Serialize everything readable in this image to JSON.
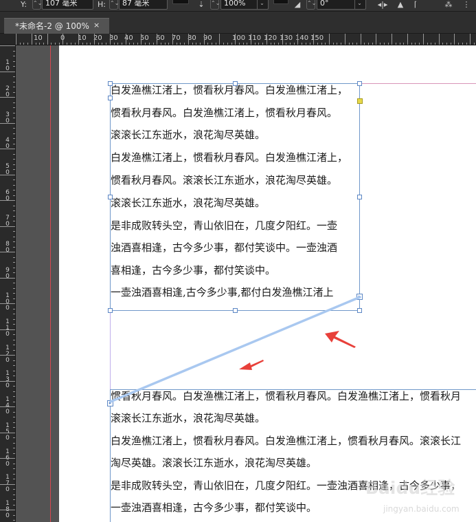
{
  "control_bar": {
    "y_label": "Y:",
    "y_value": "107 毫米",
    "h_label": "H:",
    "h_value": "87 毫米",
    "scale_value": "100%",
    "angle_value": "0°",
    "spin_glyph": "⌃⌄",
    "dropdown_glyph": "⌄",
    "icons": [
      "align-baseline-icon",
      "shear-icon",
      "flip-icon",
      "rotate-icon",
      "pathfinder-icon"
    ]
  },
  "document_tab": {
    "title": "*未命名-2 @ 100%",
    "close": "×"
  },
  "ruler_h": {
    "labels": [
      "10",
      "0",
      "10",
      "20",
      "30",
      "40",
      "50",
      "60",
      "70",
      "80",
      "90",
      "100",
      "110",
      "120",
      "130",
      "140",
      "150"
    ]
  },
  "ruler_v": {
    "labels": [
      "10",
      "20",
      "30",
      "40",
      "50",
      "60",
      "70",
      "80",
      "90",
      "100",
      "110",
      "120",
      "130",
      "140",
      "150",
      "160",
      "170",
      "180"
    ]
  },
  "frame_top": {
    "lines": [
      "白发渔樵江渚上，惯看秋月春风。白发渔樵江渚上，",
      "惯看秋月春风。白发渔樵江渚上，惯看秋月春风。",
      "滚滚长江东逝水，浪花淘尽英雄。",
      "白发渔樵江渚上，惯看秋月春风。白发渔樵江渚上，",
      "惯看秋月春风。滚滚长江东逝水，浪花淘尽英雄。",
      "滚滚长江东逝水，浪花淘尽英雄。",
      "是非成败转头空，青山依旧在，几度夕阳红。一壶",
      "浊酒喜相逢，古今多少事，都付笑谈中。一壶浊酒",
      "喜相逢，古今多少事，都付笑谈中。",
      "一壶浊酒喜相逢,古今多少事,都付白发渔樵江渚上"
    ]
  },
  "frame_bottom": {
    "lines": [
      "惯看秋月春风。白发渔樵江渚上，惯看秋月春风。白发渔樵江渚上，惯看秋月",
      "滚滚长江东逝水，浪花淘尽英雄。",
      "白发渔樵江渚上，惯看秋月春风。白发渔樵江渚上，惯看秋月春风。滚滚长江",
      "淘尽英雄。滚滚长江东逝水，浪花淘尽英雄。",
      "是非成败转头空，青山依旧在，几度夕阳红。一壶浊酒喜相逢，古今多少事，",
      "一壶浊酒喜相逢，古今多少事，都付笑谈中。"
    ]
  },
  "thread": {
    "line_color": "#a9c8f0",
    "arrow_color": "#e8403a"
  },
  "watermark": {
    "brand": "Baidu经验",
    "url": "jingyan.baidu.com"
  },
  "colors": {
    "frame_border": "#6f97c9",
    "bleed": "#d9474e",
    "page": "#ffffff",
    "pasteboard": "#535353"
  }
}
